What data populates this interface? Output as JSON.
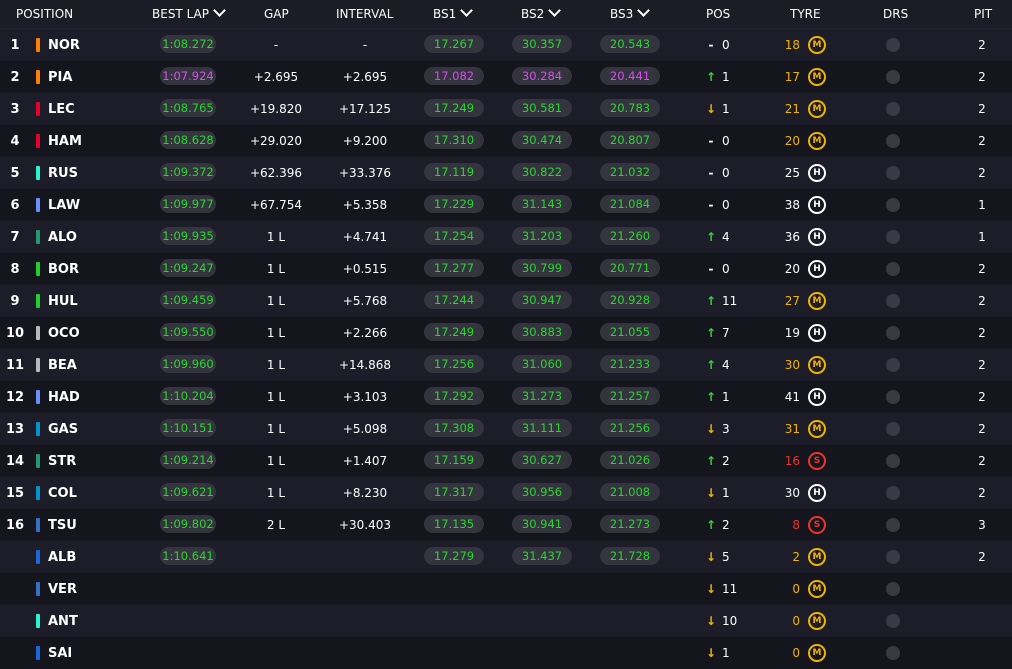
{
  "headers": {
    "position": "POSITION",
    "best_lap": "BEST LAP",
    "gap": "GAP",
    "interval": "INTERVAL",
    "bs1": "BS1",
    "bs2": "BS2",
    "bs3": "BS3",
    "pos": "POS",
    "tyre": "TYRE",
    "drs": "DRS",
    "pit": "PIT"
  },
  "colors": {
    "sector_green": "#2bd52f",
    "sector_purple": "#d94bf0",
    "arrow_up": "#3ad13a",
    "arrow_down": "#f0b400",
    "tyre_medium": "#f0b400",
    "tyre_hard": "#ffffff",
    "tyre_soft": "#e8352c"
  },
  "drivers": [
    {
      "pos": "1",
      "code": "NOR",
      "team_color": "#ff8000",
      "best_lap": "1:08.272",
      "best_lap_color": "green",
      "gap": "-",
      "interval": "-",
      "bs1": "17.267",
      "bs1_color": "green",
      "bs2": "30.357",
      "bs2_color": "green",
      "bs3": "20.543",
      "bs3_color": "green",
      "pos_change": "0",
      "pos_dir": "same",
      "tyre_laps": "18",
      "tyre": "M",
      "drs_icon": "drs-indicator-off",
      "pit": "2"
    },
    {
      "pos": "2",
      "code": "PIA",
      "team_color": "#ff8000",
      "best_lap": "1:07.924",
      "best_lap_color": "purple",
      "gap": "+2.695",
      "interval": "+2.695",
      "bs1": "17.082",
      "bs1_color": "purple",
      "bs2": "30.284",
      "bs2_color": "purple",
      "bs3": "20.441",
      "bs3_color": "purple",
      "pos_change": "1",
      "pos_dir": "up",
      "tyre_laps": "17",
      "tyre": "M",
      "drs_icon": "drs-indicator-off",
      "pit": "2"
    },
    {
      "pos": "3",
      "code": "LEC",
      "team_color": "#e8002d",
      "best_lap": "1:08.765",
      "best_lap_color": "green",
      "gap": "+19.820",
      "interval": "+17.125",
      "bs1": "17.249",
      "bs1_color": "green",
      "bs2": "30.581",
      "bs2_color": "green",
      "bs3": "20.783",
      "bs3_color": "green",
      "pos_change": "1",
      "pos_dir": "down",
      "tyre_laps": "21",
      "tyre": "M",
      "drs_icon": "drs-indicator-off",
      "pit": "2"
    },
    {
      "pos": "4",
      "code": "HAM",
      "team_color": "#e8002d",
      "best_lap": "1:08.628",
      "best_lap_color": "green",
      "gap": "+29.020",
      "interval": "+9.200",
      "bs1": "17.310",
      "bs1_color": "green",
      "bs2": "30.474",
      "bs2_color": "green",
      "bs3": "20.807",
      "bs3_color": "green",
      "pos_change": "0",
      "pos_dir": "same",
      "tyre_laps": "20",
      "tyre": "M",
      "drs_icon": "drs-indicator-off",
      "pit": "2"
    },
    {
      "pos": "5",
      "code": "RUS",
      "team_color": "#27f4d2",
      "best_lap": "1:09.372",
      "best_lap_color": "green",
      "gap": "+62.396",
      "interval": "+33.376",
      "bs1": "17.119",
      "bs1_color": "green",
      "bs2": "30.822",
      "bs2_color": "green",
      "bs3": "21.032",
      "bs3_color": "green",
      "pos_change": "0",
      "pos_dir": "same",
      "tyre_laps": "25",
      "tyre": "H",
      "drs_icon": "drs-indicator-off",
      "pit": "2"
    },
    {
      "pos": "6",
      "code": "LAW",
      "team_color": "#6692ff",
      "best_lap": "1:09.977",
      "best_lap_color": "green",
      "gap": "+67.754",
      "interval": "+5.358",
      "bs1": "17.229",
      "bs1_color": "green",
      "bs2": "31.143",
      "bs2_color": "green",
      "bs3": "21.084",
      "bs3_color": "green",
      "pos_change": "0",
      "pos_dir": "same",
      "tyre_laps": "38",
      "tyre": "H",
      "drs_icon": "drs-indicator-off",
      "pit": "1"
    },
    {
      "pos": "7",
      "code": "ALO",
      "team_color": "#229971",
      "best_lap": "1:09.935",
      "best_lap_color": "green",
      "gap": "1 L",
      "interval": "+4.741",
      "bs1": "17.254",
      "bs1_color": "green",
      "bs2": "31.203",
      "bs2_color": "green",
      "bs3": "21.260",
      "bs3_color": "green",
      "pos_change": "4",
      "pos_dir": "up",
      "tyre_laps": "36",
      "tyre": "H",
      "drs_icon": "drs-indicator-off",
      "pit": "1"
    },
    {
      "pos": "8",
      "code": "BOR",
      "team_color": "#1fd12b",
      "best_lap": "1:09.247",
      "best_lap_color": "green",
      "gap": "1 L",
      "interval": "+0.515",
      "bs1": "17.277",
      "bs1_color": "green",
      "bs2": "30.799",
      "bs2_color": "green",
      "bs3": "20.771",
      "bs3_color": "green",
      "pos_change": "0",
      "pos_dir": "same",
      "tyre_laps": "20",
      "tyre": "H",
      "drs_icon": "drs-indicator-off",
      "pit": "2"
    },
    {
      "pos": "9",
      "code": "HUL",
      "team_color": "#1fd12b",
      "best_lap": "1:09.459",
      "best_lap_color": "green",
      "gap": "1 L",
      "interval": "+5.768",
      "bs1": "17.244",
      "bs1_color": "green",
      "bs2": "30.947",
      "bs2_color": "green",
      "bs3": "20.928",
      "bs3_color": "green",
      "pos_change": "11",
      "pos_dir": "up",
      "tyre_laps": "27",
      "tyre": "M",
      "drs_icon": "drs-indicator-off",
      "pit": "2"
    },
    {
      "pos": "10",
      "code": "OCO",
      "team_color": "#b6babd",
      "best_lap": "1:09.550",
      "best_lap_color": "green",
      "gap": "1 L",
      "interval": "+2.266",
      "bs1": "17.249",
      "bs1_color": "green",
      "bs2": "30.883",
      "bs2_color": "green",
      "bs3": "21.055",
      "bs3_color": "green",
      "pos_change": "7",
      "pos_dir": "up",
      "tyre_laps": "19",
      "tyre": "H",
      "drs_icon": "drs-indicator-off",
      "pit": "2"
    },
    {
      "pos": "11",
      "code": "BEA",
      "team_color": "#b6babd",
      "best_lap": "1:09.960",
      "best_lap_color": "green",
      "gap": "1 L",
      "interval": "+14.868",
      "bs1": "17.256",
      "bs1_color": "green",
      "bs2": "31.060",
      "bs2_color": "green",
      "bs3": "21.233",
      "bs3_color": "green",
      "pos_change": "4",
      "pos_dir": "up",
      "tyre_laps": "30",
      "tyre": "M",
      "drs_icon": "drs-indicator-off",
      "pit": "2"
    },
    {
      "pos": "12",
      "code": "HAD",
      "team_color": "#6692ff",
      "best_lap": "1:10.204",
      "best_lap_color": "green",
      "gap": "1 L",
      "interval": "+3.103",
      "bs1": "17.292",
      "bs1_color": "green",
      "bs2": "31.273",
      "bs2_color": "green",
      "bs3": "21.257",
      "bs3_color": "green",
      "pos_change": "1",
      "pos_dir": "up",
      "tyre_laps": "41",
      "tyre": "H",
      "drs_icon": "drs-indicator-off",
      "pit": "2"
    },
    {
      "pos": "13",
      "code": "GAS",
      "team_color": "#0093cc",
      "best_lap": "1:10.151",
      "best_lap_color": "green",
      "gap": "1 L",
      "interval": "+5.098",
      "bs1": "17.308",
      "bs1_color": "green",
      "bs2": "31.111",
      "bs2_color": "green",
      "bs3": "21.256",
      "bs3_color": "green",
      "pos_change": "3",
      "pos_dir": "down",
      "tyre_laps": "31",
      "tyre": "M",
      "drs_icon": "drs-indicator-off",
      "pit": "2"
    },
    {
      "pos": "14",
      "code": "STR",
      "team_color": "#229971",
      "best_lap": "1:09.214",
      "best_lap_color": "green",
      "gap": "1 L",
      "interval": "+1.407",
      "bs1": "17.159",
      "bs1_color": "green",
      "bs2": "30.627",
      "bs2_color": "green",
      "bs3": "21.026",
      "bs3_color": "green",
      "pos_change": "2",
      "pos_dir": "up",
      "tyre_laps": "16",
      "tyre": "S",
      "drs_icon": "drs-indicator-off",
      "pit": "2"
    },
    {
      "pos": "15",
      "code": "COL",
      "team_color": "#0093cc",
      "best_lap": "1:09.621",
      "best_lap_color": "green",
      "gap": "1 L",
      "interval": "+8.230",
      "bs1": "17.317",
      "bs1_color": "green",
      "bs2": "30.956",
      "bs2_color": "green",
      "bs3": "21.008",
      "bs3_color": "green",
      "pos_change": "1",
      "pos_dir": "down",
      "tyre_laps": "30",
      "tyre": "H",
      "drs_icon": "drs-indicator-off",
      "pit": "2"
    },
    {
      "pos": "16",
      "code": "TSU",
      "team_color": "#3671c6",
      "best_lap": "1:09.802",
      "best_lap_color": "green",
      "gap": "2 L",
      "interval": "+30.403",
      "bs1": "17.135",
      "bs1_color": "green",
      "bs2": "30.941",
      "bs2_color": "green",
      "bs3": "21.273",
      "bs3_color": "green",
      "pos_change": "2",
      "pos_dir": "up",
      "tyre_laps": "8",
      "tyre": "S",
      "drs_icon": "drs-indicator-off",
      "pit": "3"
    },
    {
      "pos": "",
      "code": "ALB",
      "team_color": "#1868db",
      "best_lap": "1:10.641",
      "best_lap_color": "green",
      "gap": "",
      "interval": "",
      "bs1": "17.279",
      "bs1_color": "green",
      "bs2": "31.437",
      "bs2_color": "green",
      "bs3": "21.728",
      "bs3_color": "green",
      "pos_change": "5",
      "pos_dir": "down",
      "tyre_laps": "2",
      "tyre": "M",
      "drs_icon": "drs-indicator-off",
      "pit": "2"
    },
    {
      "pos": "",
      "code": "VER",
      "team_color": "#3671c6",
      "best_lap": "",
      "best_lap_color": "green",
      "gap": "",
      "interval": "",
      "bs1": "",
      "bs1_color": "green",
      "bs2": "",
      "bs2_color": "green",
      "bs3": "",
      "bs3_color": "green",
      "pos_change": "11",
      "pos_dir": "down",
      "tyre_laps": "0",
      "tyre": "M",
      "drs_icon": "drs-indicator-off",
      "pit": ""
    },
    {
      "pos": "",
      "code": "ANT",
      "team_color": "#27f4d2",
      "best_lap": "",
      "best_lap_color": "green",
      "gap": "",
      "interval": "",
      "bs1": "",
      "bs1_color": "green",
      "bs2": "",
      "bs2_color": "green",
      "bs3": "",
      "bs3_color": "green",
      "pos_change": "10",
      "pos_dir": "down",
      "tyre_laps": "0",
      "tyre": "M",
      "drs_icon": "drs-indicator-off",
      "pit": ""
    },
    {
      "pos": "",
      "code": "SAI",
      "team_color": "#1868db",
      "best_lap": "",
      "best_lap_color": "green",
      "gap": "",
      "interval": "",
      "bs1": "",
      "bs1_color": "green",
      "bs2": "",
      "bs2_color": "green",
      "bs3": "",
      "bs3_color": "green",
      "pos_change": "1",
      "pos_dir": "down",
      "tyre_laps": "0",
      "tyre": "M",
      "drs_icon": "drs-indicator-off",
      "pit": ""
    }
  ]
}
